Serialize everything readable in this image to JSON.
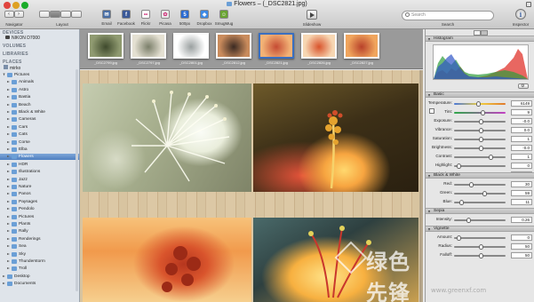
{
  "window": {
    "title": "Flowers – (_DSC2821.jpg)"
  },
  "toolbar": {
    "navigator_label": "Navigator",
    "layout_label": "Layout",
    "slideshow_label": "Slideshow",
    "search_label": "Search",
    "inspector_label": "Inspector",
    "search_placeholder": "Search",
    "share_items": [
      {
        "label": "Email",
        "icon": "email-icon",
        "color": "#4a6fa5",
        "glyph": "✉"
      },
      {
        "label": "Facebook",
        "icon": "facebook-icon",
        "color": "#3b5998",
        "glyph": "f"
      },
      {
        "label": "Flickr",
        "icon": "flickr-icon",
        "color": "#ffffff",
        "glyph": "••"
      },
      {
        "label": "Picasa",
        "icon": "picasa-icon",
        "color": "#e9e9e9",
        "glyph": "✿"
      },
      {
        "label": "500px",
        "icon": "500px-icon",
        "color": "#2a6ad1",
        "glyph": "5"
      },
      {
        "label": "Dropbox",
        "icon": "dropbox-icon",
        "color": "#3d8ae6",
        "glyph": "◆"
      },
      {
        "label": "SmugMug",
        "icon": "smugmug-icon",
        "color": "#6aa433",
        "glyph": "☺"
      }
    ]
  },
  "sidebar": {
    "devices_header": "DEVICES",
    "device_item": "NIKON D7000",
    "volumes_header": "VOLUMES",
    "libraries_header": "LIBRARIES",
    "places_header": "PLACES",
    "user_item": "mirko",
    "tree": [
      {
        "label": "Pictures",
        "level": 1,
        "open": true
      },
      {
        "label": "Animals",
        "level": 2
      },
      {
        "label": "Astro",
        "level": 2
      },
      {
        "label": "Bastia",
        "level": 2
      },
      {
        "label": "Beach",
        "level": 2
      },
      {
        "label": "Black & White",
        "level": 2
      },
      {
        "label": "Cameras",
        "level": 2
      },
      {
        "label": "Cars",
        "level": 2
      },
      {
        "label": "Cats",
        "level": 2
      },
      {
        "label": "Corse",
        "level": 2
      },
      {
        "label": "Elba",
        "level": 2
      },
      {
        "label": "Flowers",
        "level": 2,
        "selected": true
      },
      {
        "label": "HDR",
        "level": 2
      },
      {
        "label": "Illustrations",
        "level": 2
      },
      {
        "label": "Jazz",
        "level": 2
      },
      {
        "label": "Nature",
        "level": 2
      },
      {
        "label": "Panos",
        "level": 2
      },
      {
        "label": "Paysages",
        "level": 2
      },
      {
        "label": "Pendolo",
        "level": 2
      },
      {
        "label": "Pictures",
        "level": 2
      },
      {
        "label": "Plants",
        "level": 2
      },
      {
        "label": "Rally",
        "level": 2
      },
      {
        "label": "Renderings",
        "level": 2
      },
      {
        "label": "Sea",
        "level": 2
      },
      {
        "label": "Sky",
        "level": 2
      },
      {
        "label": "Thunderstorm",
        "level": 2
      },
      {
        "label": "Troll",
        "level": 2
      },
      {
        "label": "Desktop",
        "level": 1
      },
      {
        "label": "Documents",
        "level": 1
      }
    ]
  },
  "thumbnails": [
    {
      "name": "_DSC2799.jpg",
      "c1": "#8f9a70",
      "c2": "#3f4a2d"
    },
    {
      "name": "_DSC2797.jpg",
      "c1": "#e4e0d2",
      "c2": "#7b7f6a"
    },
    {
      "name": "_DSC2801.jpg",
      "c1": "#ffffff",
      "c2": "#9aa0a0"
    },
    {
      "name": "_DSC2812.jpg",
      "c1": "#c98b5c",
      "c2": "#3b2a22"
    },
    {
      "name": "_DSC2821.jpg",
      "c1": "#f2b276",
      "c2": "#c54b33",
      "selected": true
    },
    {
      "name": "_DSC2826.jpg",
      "c1": "#f7d7b3",
      "c2": "#d9542c"
    },
    {
      "name": "_DSC2827.jpg",
      "c1": "#f0a55d",
      "c2": "#b8412a"
    }
  ],
  "inspector": {
    "histogram_label": "Histogram",
    "basic_label": "Basic",
    "bw_label": "Black & White",
    "sepia_label": "Sepia",
    "vignette_label": "Vignette",
    "basic_rows": [
      {
        "label": "Temperature:",
        "value": "6149",
        "pos": 0.45
      },
      {
        "label": "Tint:",
        "value": "9",
        "pos": 0.55
      },
      {
        "label": "Exposure:",
        "value": "-0.0",
        "pos": 0.5
      },
      {
        "label": "Vibrance:",
        "value": "0.0",
        "pos": 0.5
      },
      {
        "label": "Saturation:",
        "value": "1",
        "pos": 0.5
      },
      {
        "label": "Brightness:",
        "value": "-0.0",
        "pos": 0.5
      },
      {
        "label": "Contrast:",
        "value": "1",
        "pos": 0.7
      },
      {
        "label": "Highlight:",
        "value": "0",
        "pos": 0.05
      },
      {
        "label": "Shadow:",
        "value": "0",
        "pos": 0.05
      }
    ],
    "bw_rows": [
      {
        "label": "Red:",
        "value": "30",
        "pos": 0.3
      },
      {
        "label": "Green:",
        "value": "59",
        "pos": 0.59
      },
      {
        "label": "Blue:",
        "value": "11",
        "pos": 0.11
      }
    ],
    "sepia_rows": [
      {
        "label": "Intensity:",
        "value": "0.26",
        "pos": 0.26
      }
    ],
    "vignette_rows": [
      {
        "label": "Amount:",
        "value": "0",
        "pos": 0.05
      },
      {
        "label": "Radius:",
        "value": "50",
        "pos": 0.5
      },
      {
        "label": "Falloff:",
        "value": "50",
        "pos": 0.5
      }
    ]
  },
  "colors": {
    "accent": "#4f7fc0",
    "histogram_red": "#e0342c",
    "histogram_green": "#2f9d3a",
    "histogram_blue": "#2f55c8"
  },
  "watermark": {
    "text": "绿色先锋",
    "url": "www.greenxf.com"
  }
}
